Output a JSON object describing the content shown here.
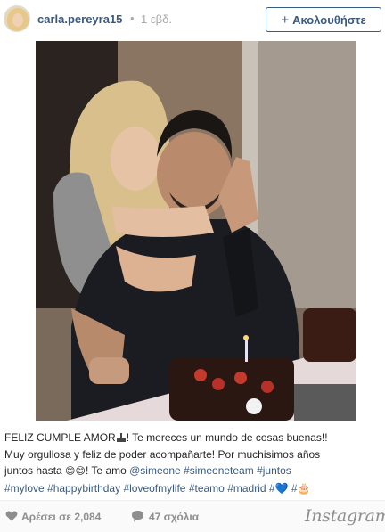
{
  "post": {
    "username": "carla.pereyra15",
    "separator": "•",
    "time_ago": "1 εβδ.",
    "follow_label": "Ακολουθήστε",
    "follow_symbol": "+"
  },
  "caption": {
    "line1_a": "FELIZ CUMPLE AMOR",
    "line1_b": "! Te mereces un mundo de cosas buenas!!",
    "line2": "Muy orgullosa y feliz de poder acompañarte! Por muchisimos años",
    "line3_a": "juntos hasta ",
    "line3_emoji": "😊😊",
    "line3_b": "! Te amo ",
    "mention": "@simeone",
    "tags_line3": [
      "#simeoneteam",
      "#juntos"
    ],
    "tags_line4": [
      "#mylove",
      "#happybirthday",
      "#loveofmylife",
      "#teamo",
      "#madrid",
      "#💙",
      "#🎂"
    ]
  },
  "footer": {
    "likes_label": "Αρέσει σε 2,084",
    "comments_label": "47 σχόλια",
    "brand": "Instagram"
  },
  "icons": {
    "heart": "heart-icon",
    "comment": "comment-icon",
    "user_tag": "user-tag-icon"
  },
  "colors": {
    "link": "#3a5a7f",
    "muted": "#8e8e8e"
  }
}
